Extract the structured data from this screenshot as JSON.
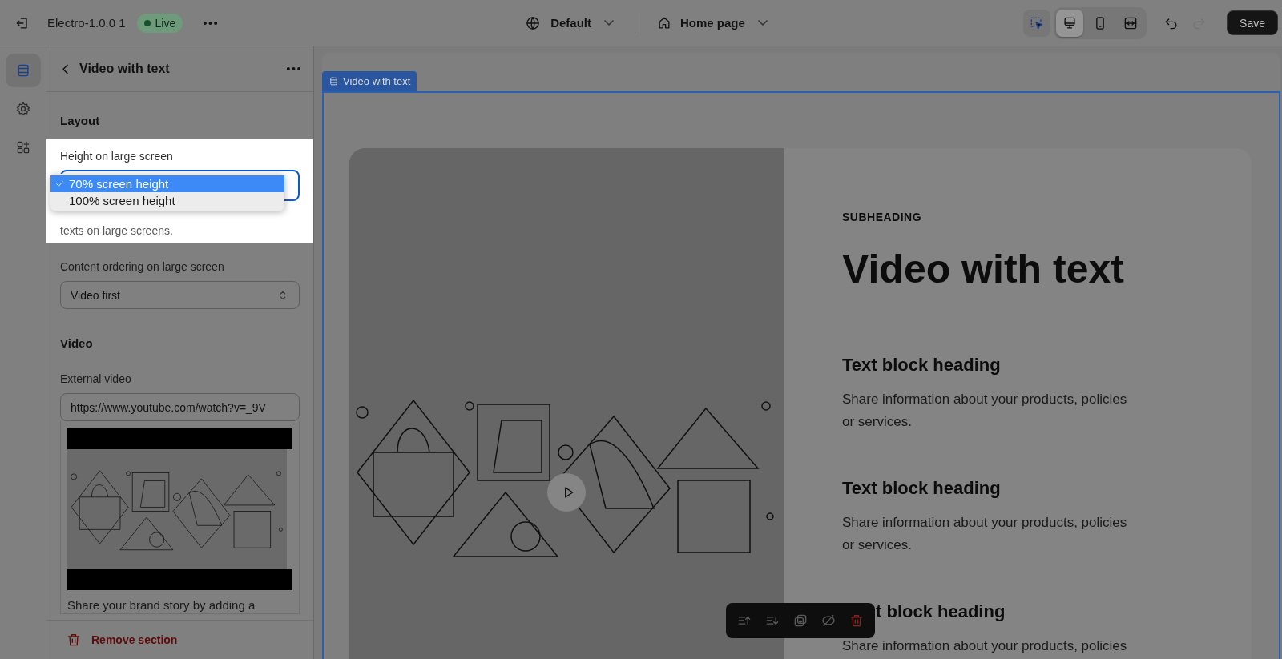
{
  "top_bar": {
    "theme_name": "Electro-1.0.0 1",
    "status_badge": "Live",
    "language": "Default",
    "page": "Home page",
    "inspector": {
      "on": true
    },
    "devices": [
      {
        "kind": "desktop",
        "selected": true
      },
      {
        "kind": "mobile",
        "selected": false
      },
      {
        "kind": "fullwidth",
        "selected": false
      }
    ],
    "redo": {
      "disabled": true
    },
    "save": "Save"
  },
  "rail": [
    {
      "kind": "sections",
      "selected": true
    },
    {
      "kind": "settings",
      "selected": false
    },
    {
      "kind": "apps",
      "selected": false
    }
  ],
  "panel": {
    "title": "Video with text",
    "layout_heading": "Layout",
    "height_label": "Height on large screen",
    "height_options": [
      {
        "label": "70% screen height",
        "selected": true
      },
      {
        "label": "100% screen height",
        "selected": false
      }
    ],
    "height_help": "texts on large screens.",
    "ordering_label": "Content ordering on large screen",
    "ordering_value": "Video first",
    "video_heading": "Video",
    "external_video_label": "External video",
    "external_video_value": "https://www.youtube.com/watch?v=_9V",
    "video_caption": "Share your brand story by adding a",
    "remove": "Remove section"
  },
  "preview": {
    "section_tag": "Video with text",
    "subheading": "SUBHEADING",
    "heading": "Video with text",
    "blocks": [
      {
        "heading": "Text block heading",
        "text": "Share information about your products, policies or services."
      },
      {
        "heading": "Text block heading",
        "text": "Share information about your products, policies or services."
      },
      {
        "heading": "t block heading",
        "text": "Share information about your products, policies"
      }
    ],
    "toolbar": [
      {
        "kind": "move-up"
      },
      {
        "kind": "move-down"
      },
      {
        "kind": "duplicate"
      },
      {
        "kind": "hide"
      },
      {
        "kind": "remove"
      }
    ]
  }
}
